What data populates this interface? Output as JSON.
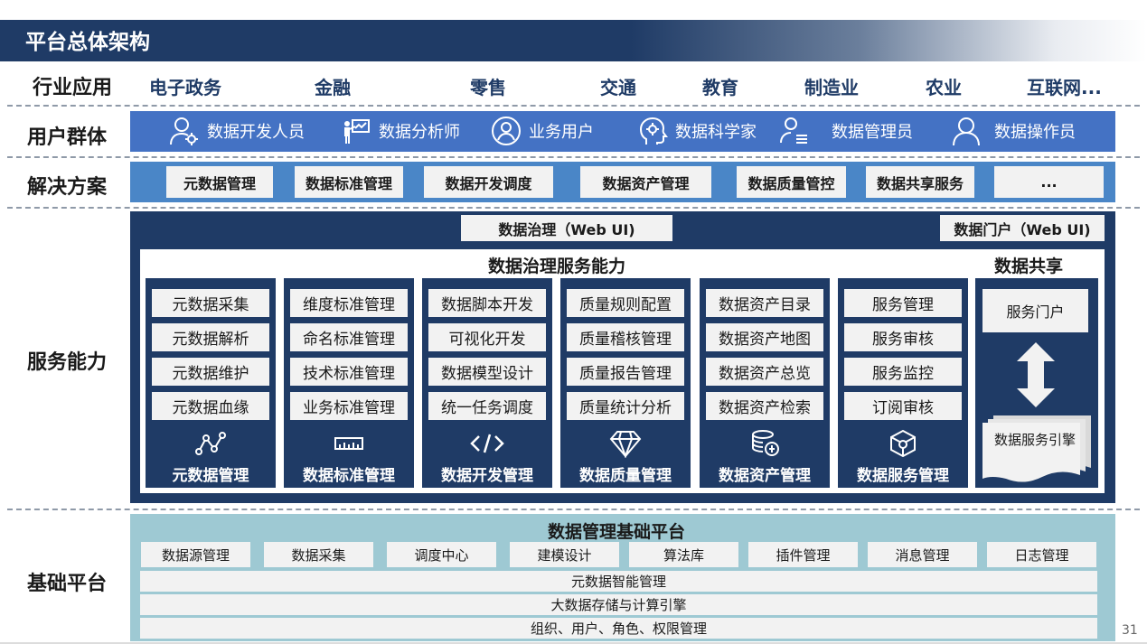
{
  "title": "平台总体架构",
  "rows": {
    "industry": "行业应用",
    "users": "用户群体",
    "solutions": "解决方案",
    "service": "服务能力",
    "base": "基础平台"
  },
  "industries": [
    "电子政务",
    "金融",
    "零售",
    "交通",
    "教育",
    "制造业",
    "农业",
    "互联网..."
  ],
  "users": [
    {
      "label": "数据开发人员",
      "icon": "user-gear-icon"
    },
    {
      "label": "数据分析师",
      "icon": "presenter-icon"
    },
    {
      "label": "业务用户",
      "icon": "user-circle-icon"
    },
    {
      "label": "数据科学家",
      "icon": "head-gear-icon"
    },
    {
      "label": "数据管理员",
      "icon": "user-list-icon"
    },
    {
      "label": "数据操作员",
      "icon": "user-outline-icon"
    }
  ],
  "solutions": [
    "元数据管理",
    "数据标准管理",
    "数据开发调度",
    "数据资产管理",
    "数据质量管控",
    "数据共享服务",
    "..."
  ],
  "service": {
    "webui_governance": "数据治理（Web UI)",
    "webui_portal": "数据门户（Web UI)",
    "governance_title": "数据治理服务能力",
    "share_title": "数据共享",
    "columns": [
      {
        "name": "元数据管理",
        "icon": "graph-nodes-icon",
        "items": [
          "元数据采集",
          "元数据解析",
          "元数据维护",
          "元数据血缘"
        ]
      },
      {
        "name": "数据标准管理",
        "icon": "ruler-icon",
        "items": [
          "维度标准管理",
          "命名标准管理",
          "技术标准管理",
          "业务标准管理"
        ]
      },
      {
        "name": "数据开发管理",
        "icon": "code-icon",
        "items": [
          "数据脚本开发",
          "可视化开发",
          "数据模型设计",
          "统一任务调度"
        ]
      },
      {
        "name": "数据质量管理",
        "icon": "diamond-icon",
        "items": [
          "质量规则配置",
          "质量稽核管理",
          "质量报告管理",
          "质量统计分析"
        ]
      },
      {
        "name": "数据资产管理",
        "icon": "coin-stack-icon",
        "items": [
          "数据资产目录",
          "数据资产地图",
          "数据资产总览",
          "数据资产检索"
        ]
      },
      {
        "name": "数据服务管理",
        "icon": "cube-gear-icon",
        "items": [
          "服务管理",
          "服务审核",
          "服务监控",
          "订阅审核"
        ]
      }
    ],
    "share_portal": "服务门户",
    "share_engine": "数据服务引擎"
  },
  "base": {
    "title": "数据管理基础平台",
    "modules": [
      "数据源管理",
      "数据采集",
      "调度中心",
      "建模设计",
      "算法库",
      "插件管理",
      "消息管理",
      "日志管理"
    ],
    "strips": [
      "元数据智能管理",
      "大数据存储与计算引擎",
      "组织、用户、角色、权限管理"
    ]
  },
  "page_number": "31",
  "colors": {
    "navy": "#1f3b66",
    "user_band": "#4472c4",
    "solution_band": "#4a86c7",
    "base_band": "#9ec9d3",
    "industry_text": "#1f3b66"
  }
}
